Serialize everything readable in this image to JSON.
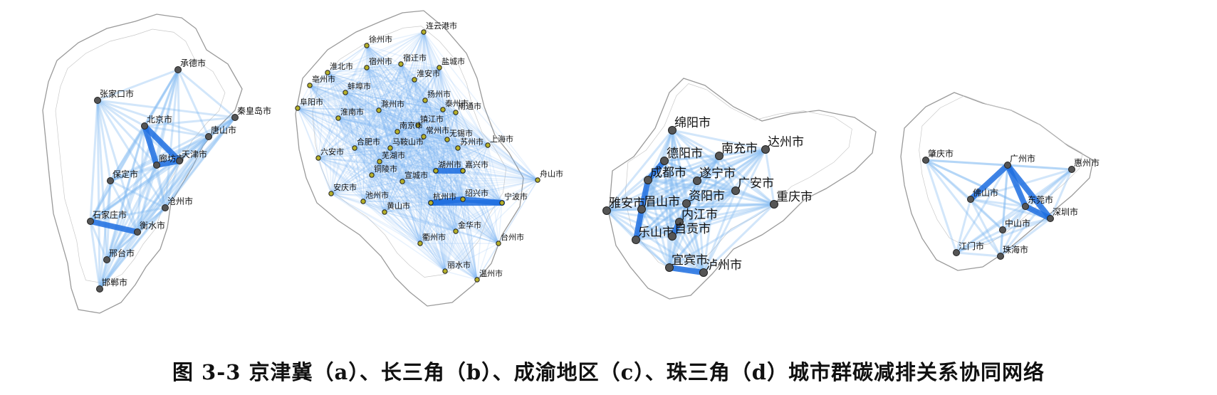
{
  "caption": "图 3-3  京津冀（a）、长三角（b）、成渝地区（c）、珠三角（d）城市群碳减排关系协同网络",
  "colors": {
    "edge": "#1f6fe0",
    "edge_light": "#7fb6f2",
    "node_dark": "#555555",
    "node_yellow": "#b5b02a",
    "border": "#9a9a9a"
  },
  "panels": [
    {
      "id": "a",
      "node_style": "dark",
      "cities": [
        {
          "name": "承德市"
        },
        {
          "name": "张家口市"
        },
        {
          "name": "北京市"
        },
        {
          "name": "秦皇岛市"
        },
        {
          "name": "唐山市"
        },
        {
          "name": "廊坊市"
        },
        {
          "name": "天津市"
        },
        {
          "name": "保定市"
        },
        {
          "name": "沧州市"
        },
        {
          "name": "石家庄市"
        },
        {
          "name": "衡水市"
        },
        {
          "name": "邢台市"
        },
        {
          "name": "邯郸市"
        }
      ]
    },
    {
      "id": "b",
      "node_style": "yellow",
      "cities": [
        {
          "name": "连云港市"
        },
        {
          "name": "徐州市"
        },
        {
          "name": "宿州市"
        },
        {
          "name": "宿迁市"
        },
        {
          "name": "盐城市"
        },
        {
          "name": "淮北市"
        },
        {
          "name": "亳州市"
        },
        {
          "name": "淮安市"
        },
        {
          "name": "蚌埠市"
        },
        {
          "name": "扬州市"
        },
        {
          "name": "阜阳市"
        },
        {
          "name": "泰州市"
        },
        {
          "name": "滁州市"
        },
        {
          "name": "淮南市"
        },
        {
          "name": "南通市"
        },
        {
          "name": "镇江市"
        },
        {
          "name": "南京市"
        },
        {
          "name": "常州市"
        },
        {
          "name": "无锡市"
        },
        {
          "name": "合肥市"
        },
        {
          "name": "马鞍山市"
        },
        {
          "name": "苏州市"
        },
        {
          "name": "上海市"
        },
        {
          "name": "六安市"
        },
        {
          "name": "芜湖市"
        },
        {
          "name": "铜陵市"
        },
        {
          "name": "宣城市"
        },
        {
          "name": "湖州市"
        },
        {
          "name": "嘉兴市"
        },
        {
          "name": "安庆市"
        },
        {
          "name": "池州市"
        },
        {
          "name": "舟山市"
        },
        {
          "name": "杭州市"
        },
        {
          "name": "绍兴市"
        },
        {
          "name": "宁波市"
        },
        {
          "name": "黄山市"
        },
        {
          "name": "金华市"
        },
        {
          "name": "台州市"
        },
        {
          "name": "衢州市"
        },
        {
          "name": "丽水市"
        },
        {
          "name": "温州市"
        }
      ]
    },
    {
      "id": "c",
      "node_style": "dark",
      "cities": [
        {
          "name": "绵阳市"
        },
        {
          "name": "德阳市"
        },
        {
          "name": "南充市"
        },
        {
          "name": "达州市"
        },
        {
          "name": "成都市"
        },
        {
          "name": "遂宁市"
        },
        {
          "name": "资阳市"
        },
        {
          "name": "广安市"
        },
        {
          "name": "重庆市"
        },
        {
          "name": "雅安市"
        },
        {
          "name": "眉山市"
        },
        {
          "name": "内江市"
        },
        {
          "name": "乐山市"
        },
        {
          "name": "自贡市"
        },
        {
          "name": "宜宾市"
        },
        {
          "name": "泸州市"
        }
      ]
    },
    {
      "id": "d",
      "node_style": "dark",
      "cities": [
        {
          "name": "肇庆市"
        },
        {
          "name": "广州市"
        },
        {
          "name": "惠州市"
        },
        {
          "name": "东莞市"
        },
        {
          "name": "佛山市"
        },
        {
          "name": "深圳市"
        },
        {
          "name": "中山市"
        },
        {
          "name": "江门市"
        },
        {
          "name": "珠海市"
        }
      ]
    }
  ]
}
